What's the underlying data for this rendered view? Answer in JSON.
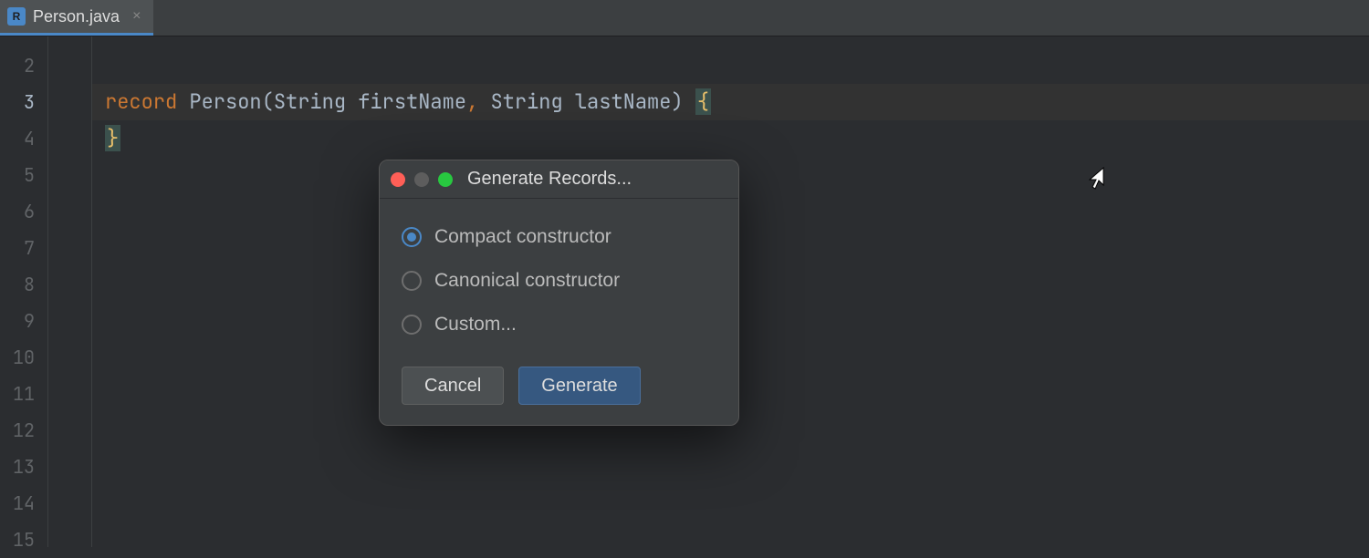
{
  "tab": {
    "icon_letter": "R",
    "label": "Person.java",
    "close_glyph": "×"
  },
  "gutter": {
    "lines": [
      "2",
      "3",
      "4",
      "5",
      "6",
      "7",
      "8",
      "9",
      "10",
      "11",
      "12",
      "13",
      "14",
      "15"
    ],
    "current_index": 1
  },
  "code": {
    "line3": {
      "keyword": "record",
      "name": "Person",
      "type1": "String",
      "param1": "firstName",
      "type2": "String",
      "param2": "lastName",
      "open_brace": "{"
    },
    "line4": {
      "close_brace": "}"
    }
  },
  "dialog": {
    "title": "Generate Records...",
    "options": [
      {
        "label": "Compact constructor",
        "selected": true
      },
      {
        "label": "Canonical constructor",
        "selected": false
      },
      {
        "label": "Custom...",
        "selected": false
      }
    ],
    "cancel_label": "Cancel",
    "primary_label": "Generate"
  }
}
